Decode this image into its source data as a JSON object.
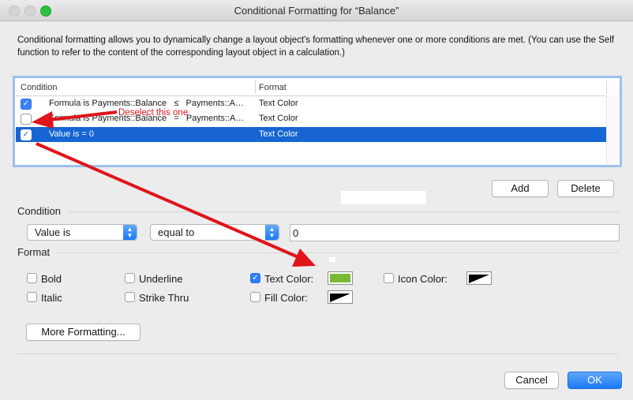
{
  "window": {
    "title": "Conditional Formatting for “Balance”"
  },
  "description": "Conditional formatting allows you to dynamically change a layout object's formatting whenever one or more conditions are met.  (You can use the Self function to refer to the content of the corresponding layout object in a calculation.)",
  "list": {
    "headers": {
      "condition": "Condition",
      "format": "Format"
    },
    "rows": [
      {
        "checked": true,
        "condition": "Formula is Payments::Balance   ≤   Payments::A…",
        "format": "Text Color",
        "selected": false
      },
      {
        "checked": false,
        "condition": "Formula is Payments::Balance   =   Payments::A…",
        "format": "Text Color",
        "selected": false
      },
      {
        "checked": true,
        "condition": "Value is = 0",
        "format": "Text Color",
        "selected": true
      }
    ]
  },
  "annotation": "Deselect this one",
  "buttons": {
    "add": "Add",
    "delete": "Delete",
    "more": "More Formatting...",
    "cancel": "Cancel",
    "ok": "OK"
  },
  "condition": {
    "label": "Condition",
    "type_value": "Value is",
    "operator_value": "equal to",
    "value": "0"
  },
  "format": {
    "label": "Format",
    "bold": {
      "label": "Bold",
      "checked": false
    },
    "italic": {
      "label": "Italic",
      "checked": false
    },
    "underline": {
      "label": "Underline",
      "checked": false
    },
    "strike": {
      "label": "Strike Thru",
      "checked": false
    },
    "text_color": {
      "label": "Text Color:",
      "checked": true,
      "color": "#7ab935"
    },
    "fill_color": {
      "label": "Fill Color:",
      "checked": false
    },
    "icon_color": {
      "label": "Icon Color:",
      "checked": false
    }
  },
  "colors": {
    "accent": "#1765d3",
    "annotation": "#e0141a"
  }
}
